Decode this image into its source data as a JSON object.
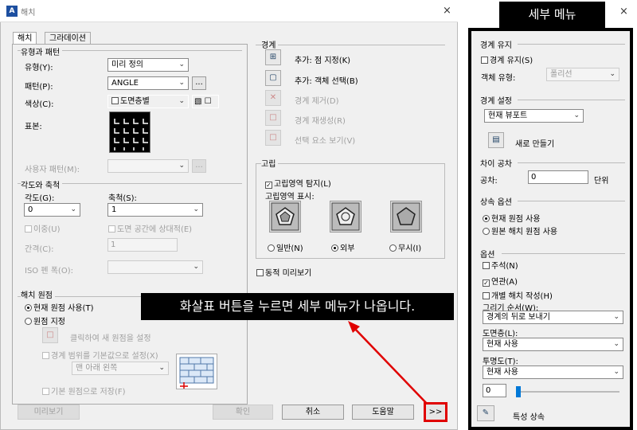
{
  "window": {
    "title": "해치",
    "close": "×"
  },
  "tabs": [
    "해치",
    "그라데이션"
  ],
  "pattern": {
    "group": "유형과 패턴",
    "type_label": "유형(Y):",
    "type_value": "미리 정의",
    "pattern_label": "패턴(P):",
    "pattern_value": "ANGLE",
    "browse": "...",
    "color_label": "색상(C):",
    "color_value": "도면층별",
    "color_extra": "▧ ☐",
    "swatch_label": "표본:",
    "custom_label": "사용자 패턴(M):",
    "custom_browse": "..."
  },
  "angle_scale": {
    "group": "각도와 축척",
    "angle_label": "각도(G):",
    "angle_value": "0",
    "scale_label": "축척(S):",
    "scale_value": "1",
    "double": "이중(U)",
    "relative": "도면 공간에 상대적(E)",
    "spacing_label": "간격(C):",
    "spacing_value": "1",
    "iso_label": "ISO 펜 폭(O):"
  },
  "origin": {
    "group": "해치 원점",
    "current": "현재 원점 사용(T)",
    "specified": "원점 지정",
    "click_set": "클릭하여 새 원점을 설정",
    "default_boundary": "경계 범위를 기본값으로 설정(X)",
    "position_value": "맨 아래 왼쪽",
    "store_default": "기본 원점으로 저장(F)"
  },
  "boundary": {
    "group": "경계",
    "add_pick": "추가: 점 지정(K)",
    "add_select": "추가: 객체 선택(B)",
    "remove": "경계 제거(D)",
    "recreate": "경계 재생성(R)",
    "view_selection": "선택 요소 보기(V)"
  },
  "islands": {
    "group": "고립",
    "detect": "고립영역 탐지(L)",
    "display_label": "고립영역 표시:",
    "normal": "일반(N)",
    "outer": "외부",
    "ignore": "무시(I)"
  },
  "dynamic_preview": "동적 미리보기",
  "buttons": {
    "preview": "미리보기",
    "ok": "확인",
    "cancel": "취소",
    "help": "도움말",
    "more": ">>"
  },
  "callout": "화살표 버튼을 누르면 세부 메뉴가 나옵니다.",
  "side": {
    "heading": "세부 메뉴",
    "close": "×",
    "retain_group": "경계 유지",
    "retain": "경계 유지(S)",
    "object_type_label": "객체 유형:",
    "object_type_value": "폴리선",
    "set_group": "경계 설정",
    "set_value": "현재 뷰포트",
    "new_label": "새로 만들기",
    "gap_group": "차이 공차",
    "gap_label": "공차:",
    "gap_value": "0",
    "gap_unit": "단위",
    "inherit_group": "상속 옵션",
    "inherit_current": "현재 원점 사용",
    "inherit_source": "원본 해치 원점 사용",
    "options_group": "옵션",
    "annotative": "주석(N)",
    "associative": "연관(A)",
    "separate": "개별 해치 작성(H)",
    "draw_order_label": "그리기 순서(W):",
    "draw_order_value": "경계의 뒤로 보내기",
    "layer_label": "도면층(L):",
    "layer_value": "현재 사용",
    "transparency_label": "투명도(T):",
    "transparency_value": "현재 사용",
    "slider_value": "0",
    "inherit_props": "특성 상속"
  },
  "colors": {
    "accent": "#0078d7",
    "highlight": "#e00000",
    "dialog_bg": "#f0f0f0"
  }
}
